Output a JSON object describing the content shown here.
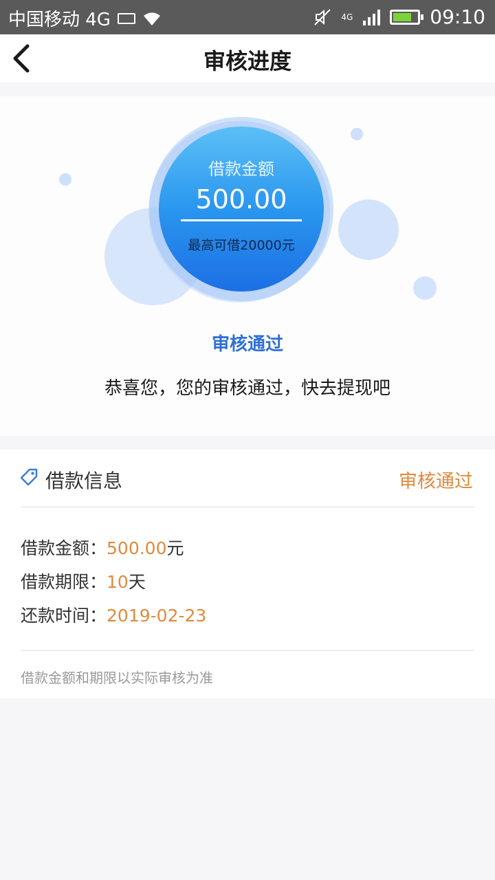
{
  "status_bar": {
    "carrier": "中国移动 4G",
    "time": "09:10",
    "network": "4G"
  },
  "header": {
    "title": "审核进度"
  },
  "loan_circle": {
    "title": "借款金额",
    "amount": "500.00",
    "max_text": "最高可借20000元"
  },
  "review": {
    "status": "审核通过",
    "message": "恭喜您，您的审核通过，快去提现吧"
  },
  "info": {
    "title": "借款信息",
    "status": "审核通过",
    "rows": [
      {
        "label": "借款金额：",
        "value": "500.00",
        "unit": "元"
      },
      {
        "label": "借款期限：",
        "value": "10",
        "unit": "天"
      },
      {
        "label": "还款时间：",
        "value": "2019-02-23",
        "unit": ""
      }
    ],
    "note": "借款金额和期限以实际审核为准"
  },
  "colors": {
    "accent_blue": "#2f6fd6",
    "accent_orange": "#e08a3c",
    "circle_top": "#5cc0f6",
    "circle_bottom": "#1c6fe4"
  }
}
